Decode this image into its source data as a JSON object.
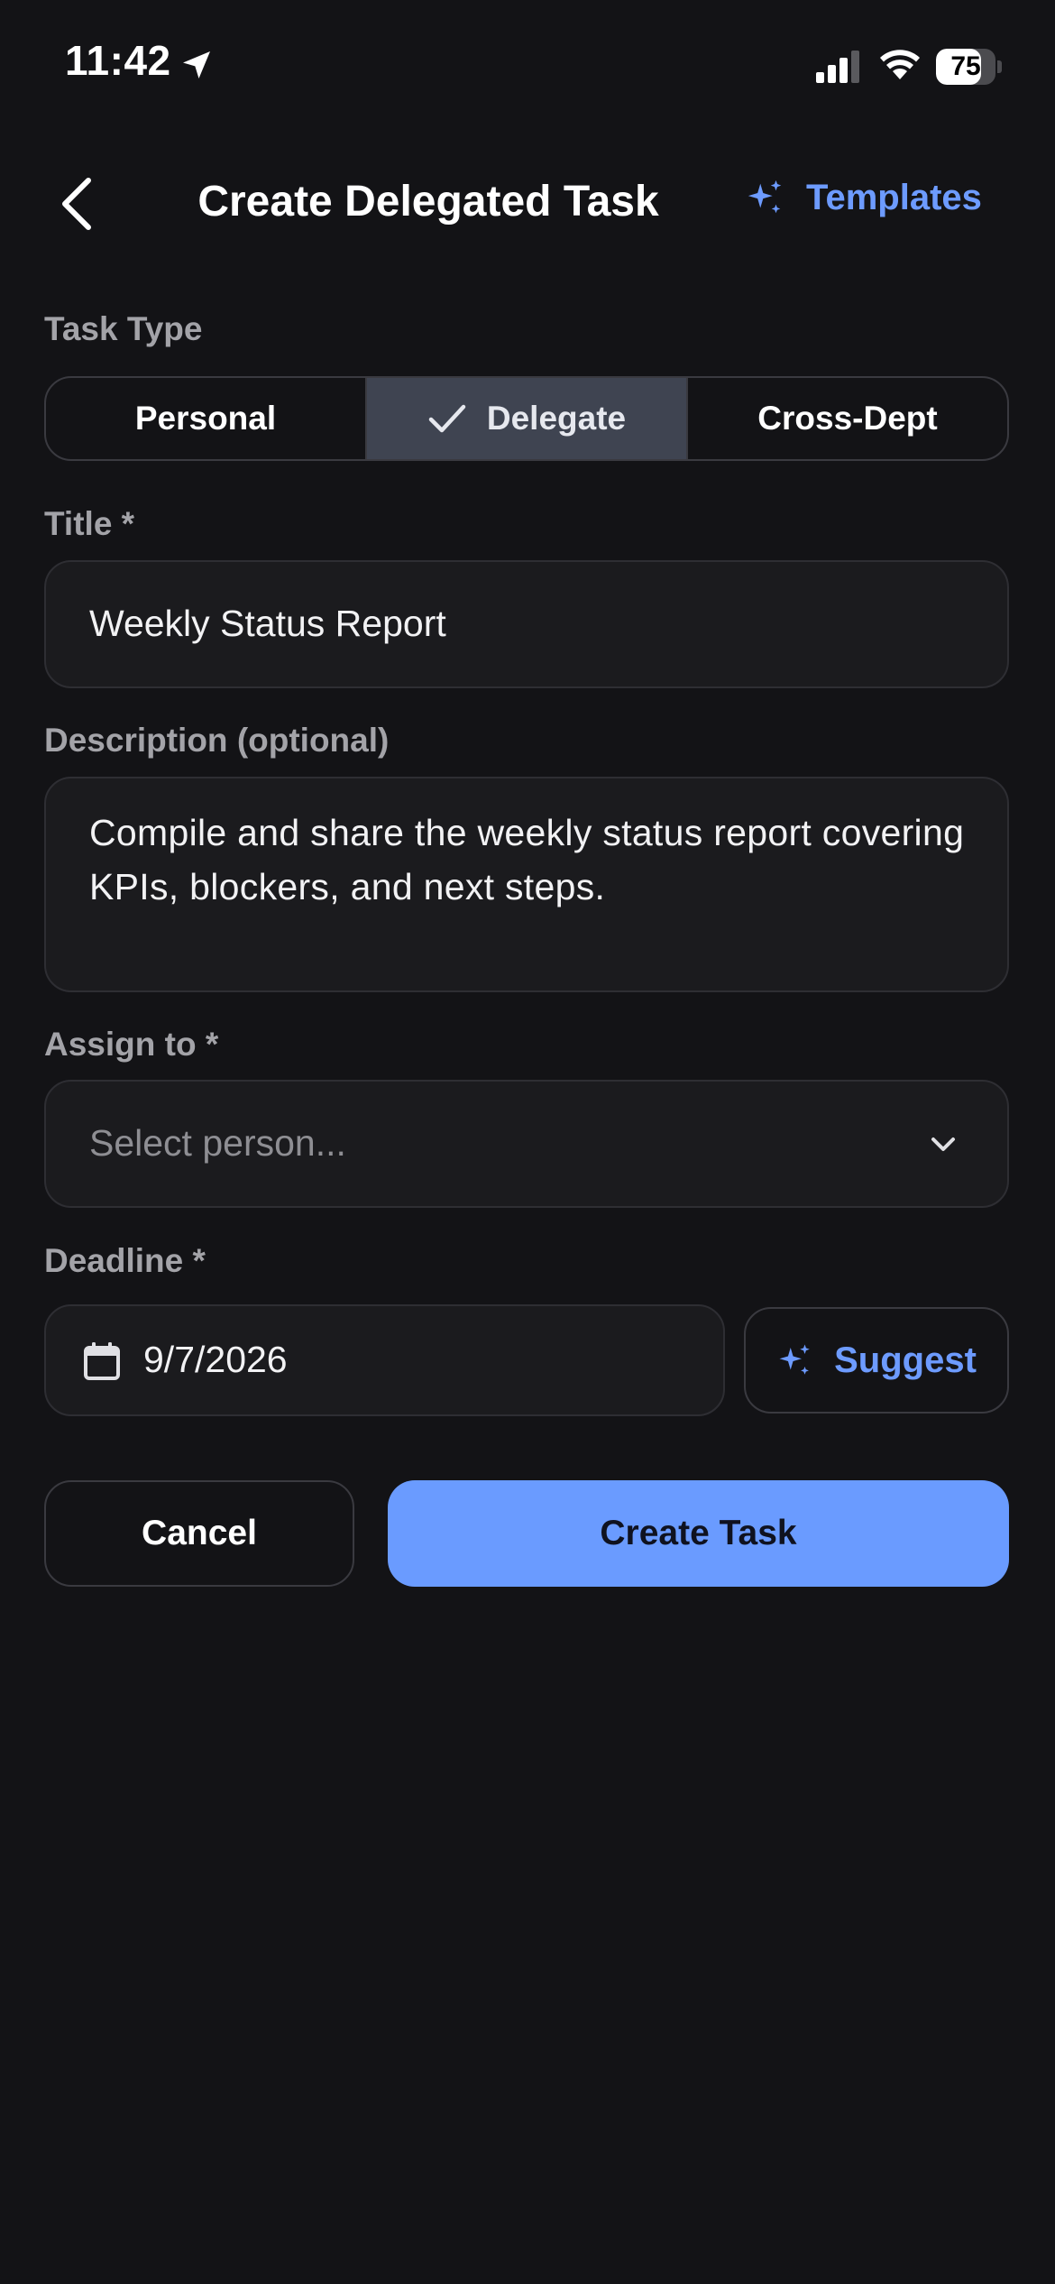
{
  "status_bar": {
    "time": "11:42",
    "battery_level": 75,
    "battery_label": "75"
  },
  "header": {
    "title": "Create Delegated Task",
    "templates_label": "Templates"
  },
  "task_type": {
    "label": "Task Type",
    "options": [
      "Personal",
      "Delegate",
      "Cross-Dept"
    ],
    "selected": "Delegate"
  },
  "title_field": {
    "label": "Title *",
    "value": "Weekly Status Report"
  },
  "description_field": {
    "label": "Description (optional)",
    "value": "Compile and share the weekly status report covering KPIs, blockers, and next steps."
  },
  "assign_field": {
    "label": "Assign to *",
    "placeholder": "Select person..."
  },
  "deadline_field": {
    "label": "Deadline *",
    "value": "9/7/2026",
    "suggest_label": "Suggest"
  },
  "actions": {
    "cancel_label": "Cancel",
    "create_label": "Create Task"
  },
  "colors": {
    "background": "#131316",
    "accent": "#6a9bff",
    "field": "#1b1b1e",
    "selected_segment": "#3f4451"
  }
}
